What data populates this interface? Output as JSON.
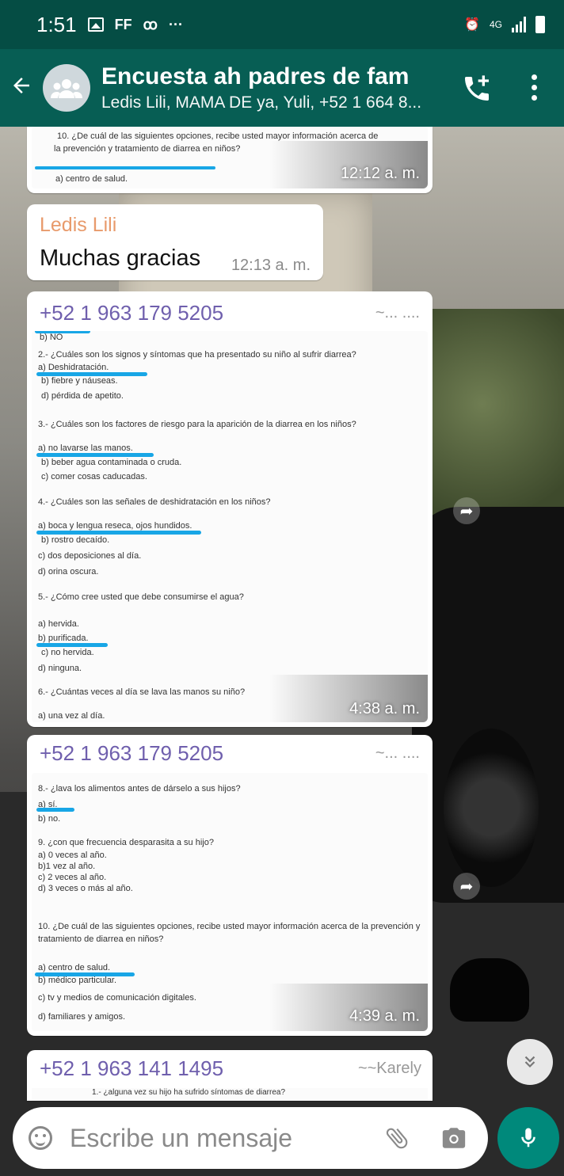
{
  "status_bar": {
    "time": "1:51",
    "carrier_tag": "FF",
    "network": "4G"
  },
  "header": {
    "title": "Encuesta ah padres de fam",
    "members": "Ledis Lili, MAMA DE ya, Yuli, +52 1 664 8..."
  },
  "messages": [
    {
      "type": "image",
      "time": "12:12 a. m.",
      "doc_lines": [
        "10. ¿De cuál de las siguientes opciones, recibe usted mayor información acerca de",
        "la prevención  y tratamiento de diarrea en niños?",
        "a) centro de salud."
      ]
    },
    {
      "type": "text",
      "sender": "Ledis Lili",
      "sender_color": "#e89a6b",
      "text": "Muchas gracias",
      "time": "12:13 a. m."
    },
    {
      "type": "image",
      "sender": "+52 1 963 179 5205",
      "alias": "~... ....",
      "time": "4:38 a. m.",
      "doc_lines": [
        "b) NO",
        "2.- ¿Cuáles son los signos y síntomas que ha presentado su niño al sufrir diarrea?",
        "a) Deshidratación.",
        "b) fiebre y náuseas.",
        "d) pérdida de apetito.",
        "3.- ¿Cuáles son los factores de riesgo para la aparición de la diarrea  en los niños?",
        "a) no  lavarse las manos.",
        "b) beber agua contaminada o cruda.",
        "c) comer cosas caducadas.",
        "4.- ¿Cuáles son las señales de deshidratación en los niños?",
        "a) boca y lengua reseca, ojos hundidos.",
        "b) rostro decaído.",
        "c) dos deposiciones al día.",
        "d) orina oscura.",
        "5.- ¿Cómo cree usted que debe consumirse el agua?",
        "a) hervida.",
        "b) purificada.",
        "c) no hervida.",
        "d) ninguna.",
        "6.- ¿Cuántas veces al día  se lava las manos su niño?",
        "a) una vez al día."
      ]
    },
    {
      "type": "image",
      "sender": "+52 1 963 179 5205",
      "alias": "~... ....",
      "time": "4:39 a. m.",
      "doc_lines": [
        "8.- ¿lava los alimentos antes de dárselo a sus hijos?",
        "a) sí.",
        "b) no.",
        "9. ¿con que frecuencia desparasita a su hijo?",
        "a) 0 veces al año.",
        "b)1 vez al año.",
        "c) 2 veces al año.",
        "d) 3 veces o más al año.",
        "10. ¿De cuál de las siguientes opciones, recibe usted mayor información acerca de la prevención  y",
        "tratamiento de diarrea en niños?",
        "a) centro de salud.",
        "b) médico particular.",
        "c) tv y medios de comunicación digitales.",
        "d) familiares y amigos."
      ]
    },
    {
      "type": "image",
      "sender": "+52 1 963 141 1495",
      "alias": "~~Karely",
      "doc_lines": [
        "1.- ¿alguna vez su hijo ha sufrido síntomas de  diarrea?"
      ]
    }
  ],
  "composer": {
    "placeholder": "Escribe un mensaje"
  },
  "colors": {
    "header": "#075e54",
    "status_bar": "#054d44",
    "accent": "#00897b",
    "underline": "#18a6e6"
  },
  "icons": [
    "back-arrow-icon",
    "group-avatar-icon",
    "add-call-icon",
    "more-vert-icon",
    "forward-icon",
    "double-chevron-down-icon",
    "emoji-icon",
    "attach-icon",
    "camera-icon",
    "mic-icon"
  ]
}
